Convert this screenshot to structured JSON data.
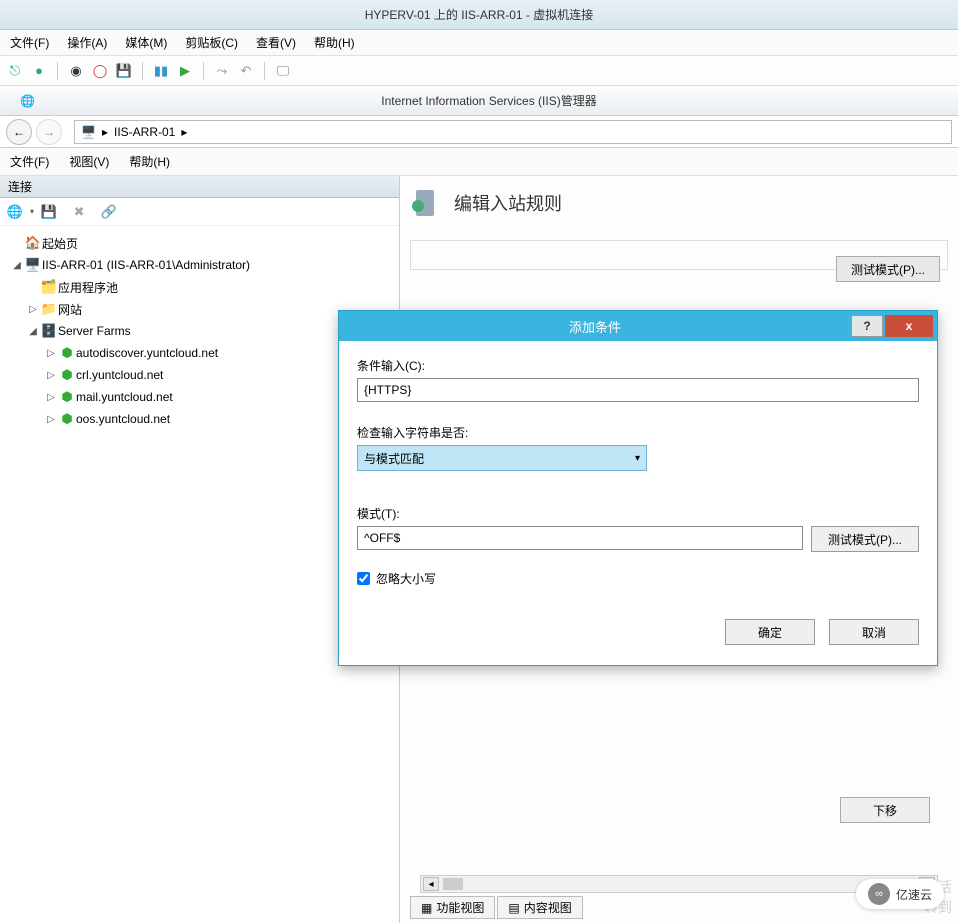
{
  "vm": {
    "title": "HYPERV-01 上的 IIS-ARR-01 - 虚拟机连接"
  },
  "vm_menu": [
    "文件(F)",
    "操作(A)",
    "媒体(M)",
    "剪贴板(C)",
    "查看(V)",
    "帮助(H)"
  ],
  "iis": {
    "title": "Internet Information Services (IIS)管理器",
    "breadcrumb_host": "IIS-ARR-01",
    "menu": [
      "文件(F)",
      "视图(V)",
      "帮助(H)"
    ],
    "connections_header": "连接",
    "page_title": "编辑入站规则",
    "test_pattern": "测试模式(P)...",
    "down_move": "下移"
  },
  "tree": {
    "start": "起始页",
    "server": "IIS-ARR-01 (IIS-ARR-01\\Administrator)",
    "apppools": "应用程序池",
    "sites": "网站",
    "farms": "Server Farms",
    "farm_items": [
      "autodiscover.yuntcloud.net",
      "crl.yuntcloud.net",
      "mail.yuntcloud.net",
      "oos.yuntcloud.net"
    ]
  },
  "dialog": {
    "title": "添加条件",
    "cond_input_label": "条件输入(C):",
    "cond_input_value": "{HTTPS}",
    "check_label": "检查输入字符串是否:",
    "check_value": "与模式匹配",
    "pattern_label": "模式(T):",
    "pattern_value": "^OFF$",
    "test_pattern": "测试模式(P)...",
    "ignore_case": "忽略大小写",
    "ok": "确定",
    "cancel": "取消",
    "help": "?",
    "close": "x"
  },
  "tabs": {
    "features": "功能视图",
    "content": "内容视图"
  },
  "brand": "亿速云"
}
